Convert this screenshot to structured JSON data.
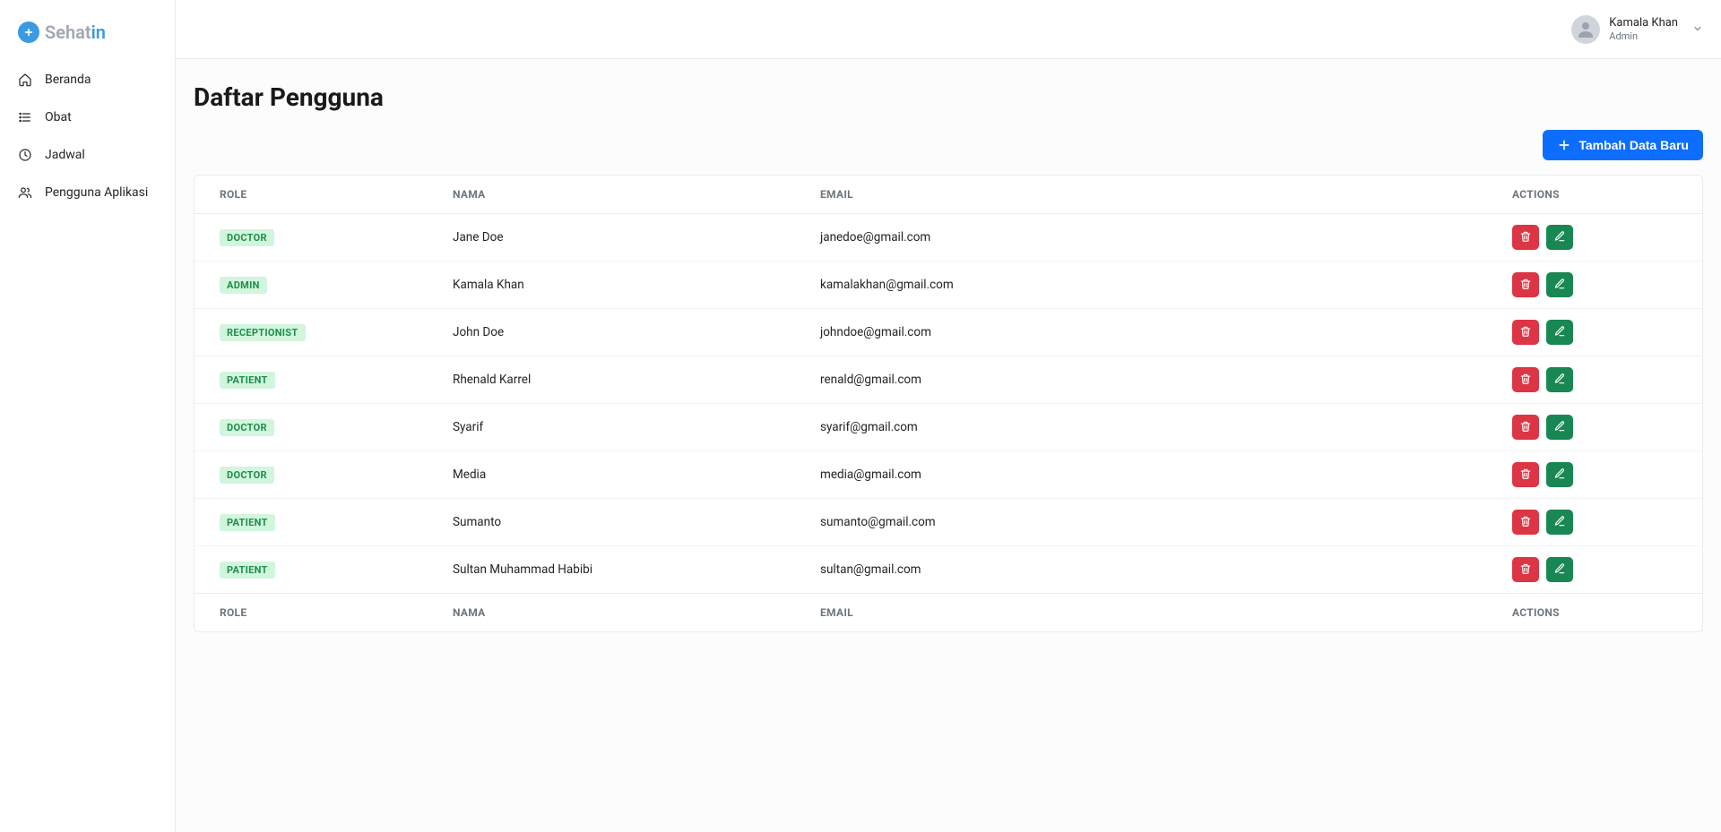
{
  "brand": {
    "part1": "Sehat",
    "part2": "in"
  },
  "sidebar": {
    "items": [
      {
        "label": "Beranda",
        "icon": "home"
      },
      {
        "label": "Obat",
        "icon": "list"
      },
      {
        "label": "Jadwal",
        "icon": "clock"
      },
      {
        "label": "Pengguna Aplikasi",
        "icon": "users"
      }
    ]
  },
  "header": {
    "user_name": "Kamala Khan",
    "user_role": "Admin"
  },
  "page": {
    "title": "Daftar Pengguna",
    "add_button": "Tambah Data Baru"
  },
  "table": {
    "columns": {
      "role": "ROLE",
      "name": "NAMA",
      "email": "EMAIL",
      "actions": "ACTIONS"
    },
    "rows": [
      {
        "role": "DOCTOR",
        "name": "Jane Doe",
        "email": "janedoe@gmail.com"
      },
      {
        "role": "ADMIN",
        "name": "Kamala Khan",
        "email": "kamalakhan@gmail.com"
      },
      {
        "role": "RECEPTIONIST",
        "name": "John Doe",
        "email": "johndoe@gmail.com"
      },
      {
        "role": "PATIENT",
        "name": "Rhenald Karrel",
        "email": "renald@gmail.com"
      },
      {
        "role": "DOCTOR",
        "name": "Syarif",
        "email": "syarif@gmail.com"
      },
      {
        "role": "DOCTOR",
        "name": "Media",
        "email": "media@gmail.com"
      },
      {
        "role": "PATIENT",
        "name": "Sumanto",
        "email": "sumanto@gmail.com"
      },
      {
        "role": "PATIENT",
        "name": "Sultan Muhammad Habibi",
        "email": "sultan@gmail.com"
      }
    ]
  }
}
